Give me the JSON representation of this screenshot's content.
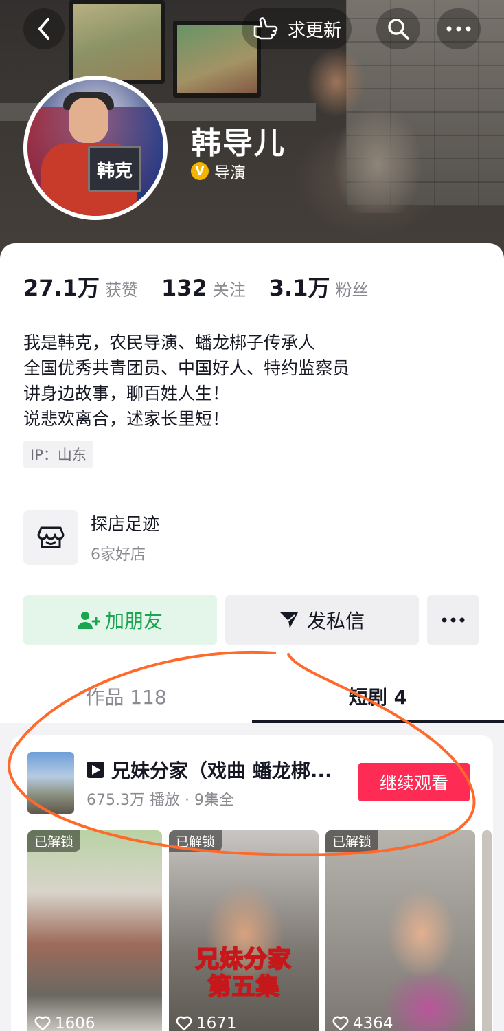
{
  "header": {
    "update_label": "求更新",
    "nickname": "韩导儿",
    "role": "导演",
    "verified_mark": "V",
    "avatar_text": "韩克"
  },
  "stats": [
    {
      "value": "27.1万",
      "label": "获赞"
    },
    {
      "value": "132",
      "label": "关注"
    },
    {
      "value": "3.1万",
      "label": "粉丝"
    }
  ],
  "bio": [
    "我是韩克，农民导演、蟠龙梆子传承人",
    "全国优秀共青团员、中国好人、特约监察员",
    "讲身边故事，聊百姓人生！",
    "说悲欢离合，述家长里短！"
  ],
  "ip": "IP：山东",
  "footprint": {
    "title": "探店足迹",
    "subtitle": "6家好店"
  },
  "actions": {
    "add_friend": "加朋友",
    "message": "发私信"
  },
  "tabs": {
    "works": "作品 118",
    "dramas": "短剧 4"
  },
  "drama": {
    "title": "兄妹分家（戏曲 蟠龙梆...",
    "meta": "675.3万 播放 · 9集全",
    "watch_label": "继续观看",
    "episodes": [
      {
        "tag": "已解锁",
        "likes": "1606"
      },
      {
        "tag": "已解锁",
        "likes": "1671",
        "banner_line1": "兄妹分家",
        "banner_line2": "第五集"
      },
      {
        "tag": "已解锁",
        "likes": "4364"
      }
    ]
  },
  "colors": {
    "accent_red": "#fe2c55",
    "add_friend_green": "#1aa551",
    "annotation_orange": "#ff6a2b"
  },
  "icons": [
    "back-arrow-icon",
    "raise-hand-icon",
    "search-icon",
    "more-dots-icon",
    "verified-icon",
    "shop-icon",
    "add-user-icon",
    "send-icon",
    "play-logo-icon",
    "heart-icon"
  ]
}
